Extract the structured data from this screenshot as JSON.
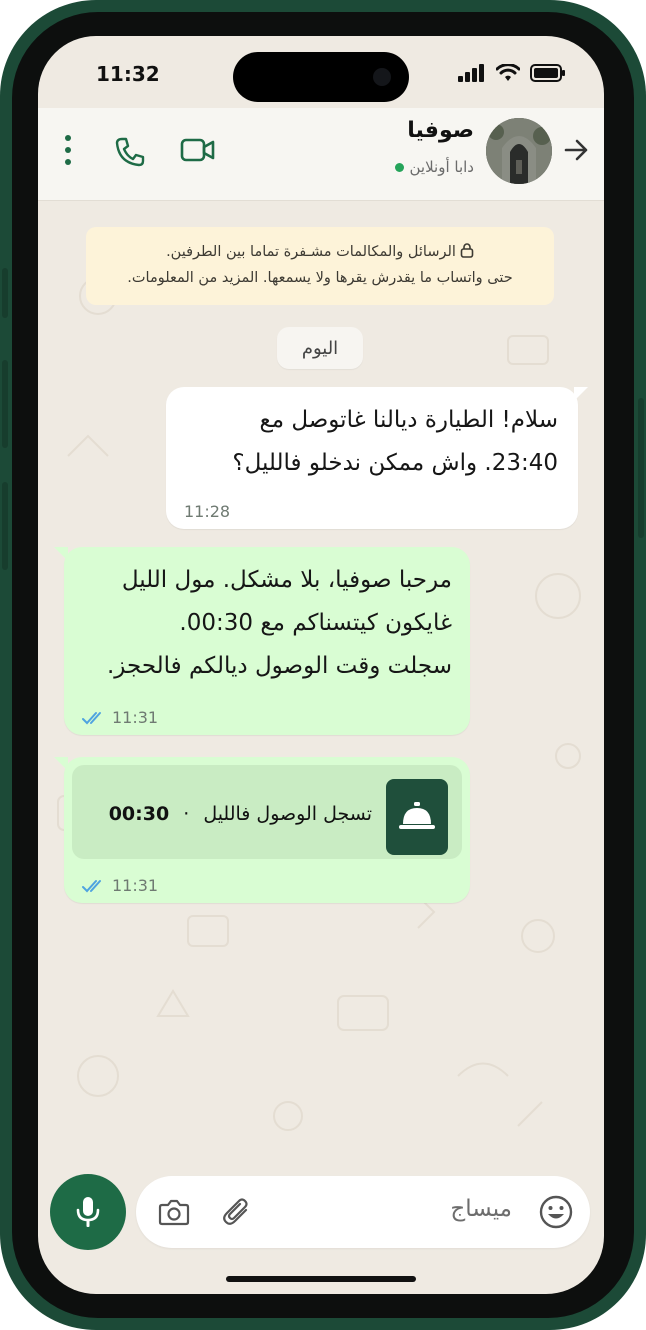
{
  "status_bar": {
    "time": "11:32"
  },
  "header": {
    "contact_name": "صوفيا",
    "contact_status": "دابا أونلاين",
    "icons": [
      "back-arrow-icon",
      "video-call-icon",
      "phone-call-icon",
      "more-options-icon"
    ]
  },
  "chat": {
    "encryption_banner": {
      "line1": "الرسائل والمكالمات مشـفرة تماما بين الطرفين.",
      "line2": "حتى واتساب ما يقدرش يقرها ولا يسمعها. المزيد من المعلومات."
    },
    "date_chip": "اليوم",
    "messages": [
      {
        "direction": "incoming",
        "lines": [
          "سلام! الطيارة ديالنا غاتوصل مع",
          "23:40. واش ممكن ندخلو فالليل؟"
        ],
        "time": "11:28"
      },
      {
        "direction": "outgoing",
        "lines": [
          "مرحبا صوفيا، بلا مشكل. مول الليل",
          "غايكون كيتسناكم مع 00:30.",
          "سجلت وقت الوصول ديالكم فالحجز."
        ],
        "time": "11:31",
        "status": "read"
      },
      {
        "direction": "outgoing",
        "card": {
          "label": "تسجل الوصول فالليل",
          "separator": "·",
          "time_value": "00:30",
          "icon": "concierge-bell-icon"
        },
        "time": "11:31",
        "status": "read"
      }
    ]
  },
  "input": {
    "placeholder": "ميساج"
  },
  "colors": {
    "frame": "#1c4a37",
    "chat_bg": "#efeae2",
    "incoming_bubble": "#ffffff",
    "outgoing_bubble": "#d9fdd3",
    "accent": "#1e6b46",
    "read_ticks": "#4fa3e0"
  }
}
